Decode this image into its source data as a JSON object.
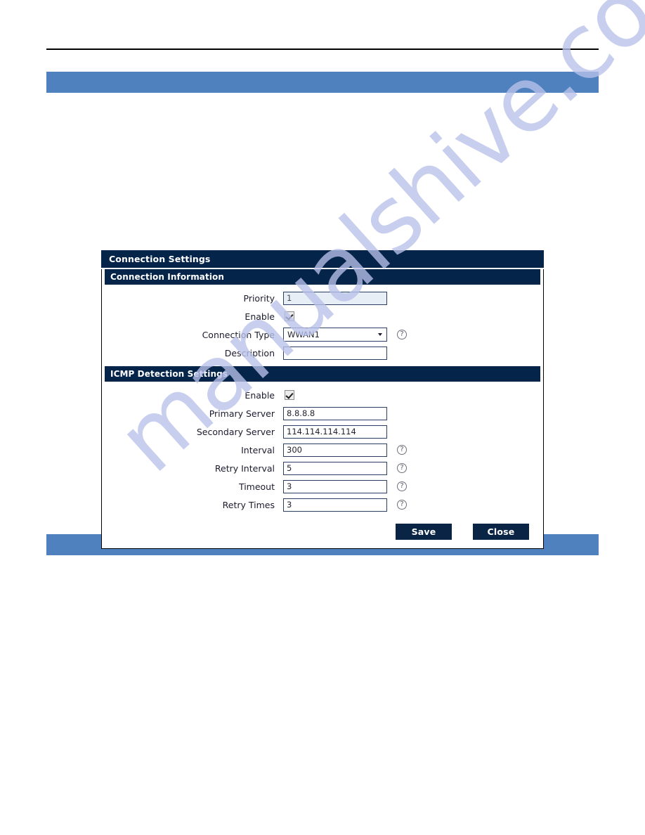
{
  "page": {
    "watermark_text": "manualshive.com",
    "accent_color": "#4e81bd",
    "panel_header_color": "#04244a",
    "button_color": "#0a2445"
  },
  "dialog": {
    "title": "Connection Settings",
    "sections": [
      {
        "id": "connection-information",
        "title": "Connection Information",
        "fields": [
          {
            "name": "priority",
            "label": "Priority",
            "type": "text",
            "value": "1",
            "readonly": true,
            "help": false
          },
          {
            "name": "enable",
            "label": "Enable",
            "type": "checkbox",
            "value": "checked",
            "help": false
          },
          {
            "name": "connection-type",
            "label": "Connection Type",
            "type": "select",
            "value": "WWAN1",
            "help": true
          },
          {
            "name": "description",
            "label": "Description",
            "type": "text",
            "value": "",
            "readonly": false,
            "help": false
          }
        ]
      },
      {
        "id": "icmp-detection-settings",
        "title": "ICMP Detection Settings",
        "fields": [
          {
            "name": "icmp-enable",
            "label": "Enable",
            "type": "checkbox",
            "value": "checked",
            "help": false
          },
          {
            "name": "primary-server",
            "label": "Primary Server",
            "type": "text",
            "value": "8.8.8.8",
            "readonly": false,
            "help": false
          },
          {
            "name": "secondary-server",
            "label": "Secondary Server",
            "type": "text",
            "value": "114.114.114.114",
            "readonly": false,
            "help": false
          },
          {
            "name": "interval",
            "label": "Interval",
            "type": "text",
            "value": "300",
            "readonly": false,
            "help": true
          },
          {
            "name": "retry-interval",
            "label": "Retry Interval",
            "type": "text",
            "value": "5",
            "readonly": false,
            "help": true
          },
          {
            "name": "timeout",
            "label": "Timeout",
            "type": "text",
            "value": "3",
            "readonly": false,
            "help": true
          },
          {
            "name": "retry-times",
            "label": "Retry Times",
            "type": "text",
            "value": "3",
            "readonly": false,
            "help": true
          }
        ]
      }
    ],
    "buttons": [
      {
        "name": "save-button",
        "label": "Save"
      },
      {
        "name": "close-button",
        "label": "Close"
      }
    ],
    "help_icon_glyph": "?"
  }
}
